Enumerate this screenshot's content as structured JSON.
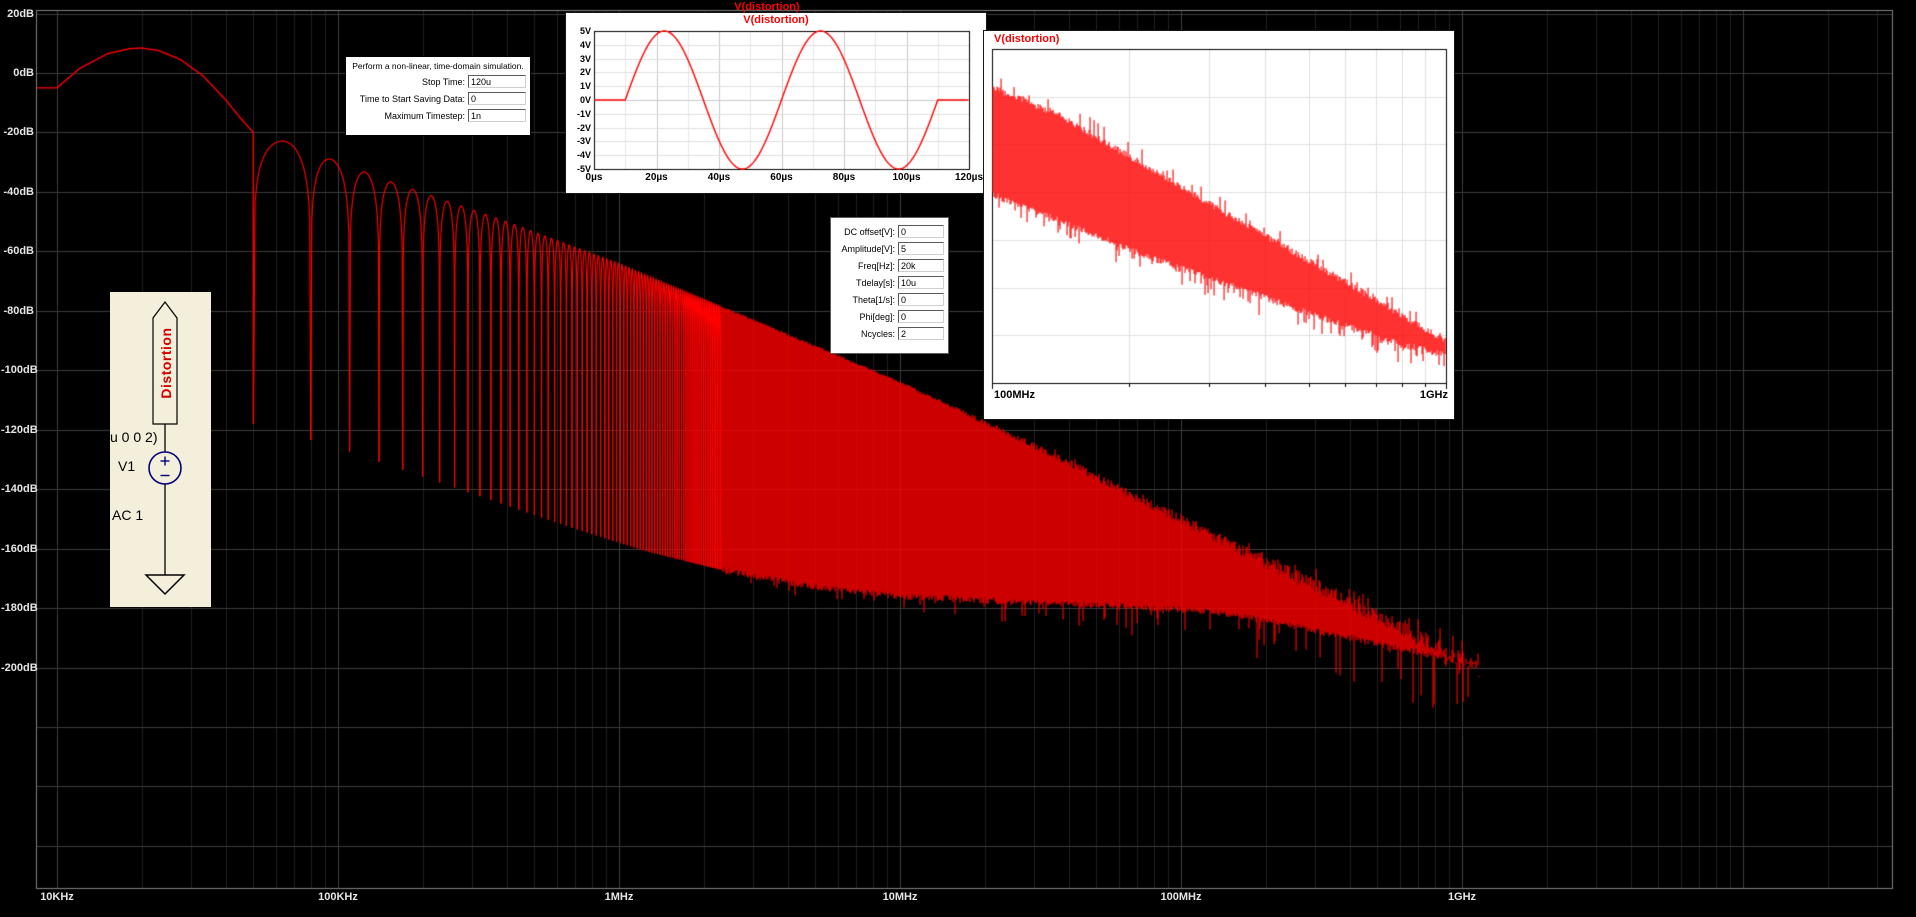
{
  "window": {
    "bg": "#000000"
  },
  "main_plot": {
    "title": "V(distortion)",
    "title_color": "#ff0000",
    "trace_color": "#ff0000",
    "grid_major": "#3d3d3d",
    "grid_minor": "#212121",
    "frame": "#828282",
    "label_color": "#e6e6e6",
    "y_labels": [
      "20dB",
      "0dB",
      "-20dB",
      "-40dB",
      "-60dB",
      "-80dB",
      "-100dB",
      "-120dB",
      "-140dB",
      "-160dB",
      "-180dB",
      "-200dB"
    ],
    "x_labels": [
      "10KHz",
      "100KHz",
      "1MHz",
      "10MHz",
      "100MHz",
      "1GHz"
    ]
  },
  "time_inset": {
    "title": "V(distortion)",
    "y_labels": [
      "5V",
      "4V",
      "3V",
      "2V",
      "1V",
      "0V",
      "-1V",
      "-2V",
      "-3V",
      "-4V",
      "-5V"
    ],
    "x_labels": [
      "0µs",
      "20µs",
      "40µs",
      "60µs",
      "80µs",
      "100µs",
      "120µs"
    ]
  },
  "zoom_inset": {
    "title": "V(distortion)",
    "x_labels": [
      "100MHz",
      "1GHz"
    ]
  },
  "transient_dialog": {
    "description": "Perform a non-linear, time-domain simulation.",
    "fields": [
      {
        "label": "Stop Time:",
        "value": "120u"
      },
      {
        "label": "Time to Start Saving Data:",
        "value": "0"
      },
      {
        "label": "Maximum Timestep:",
        "value": "1n"
      }
    ]
  },
  "sine_dialog": {
    "fields": [
      {
        "label": "DC offset[V]:",
        "value": "0"
      },
      {
        "label": "Amplitude[V]:",
        "value": "5"
      },
      {
        "label": "Freq[Hz]:",
        "value": "20k"
      },
      {
        "label": "Tdelay[s]:",
        "value": "10u"
      },
      {
        "label": "Theta[1/s]:",
        "value": "0"
      },
      {
        "label": "Phi[deg]:",
        "value": "0"
      },
      {
        "label": "Ncycles:",
        "value": "2"
      }
    ]
  },
  "schematic": {
    "net_label": "Distortion",
    "clipped_text": "u 0 0 2)",
    "ref": "V1",
    "value": "AC 1",
    "bg": "#f4efda",
    "symbol_color": "#00007f"
  },
  "chart_data": [
    {
      "id": "main-fft-spectrum",
      "type": "line",
      "title": "V(distortion)",
      "x_axis": {
        "scale": "log",
        "ticks": [
          "10KHz",
          "100KHz",
          "1MHz",
          "10MHz",
          "100MHz",
          "1GHz"
        ],
        "tick_hz": [
          10000,
          100000,
          1000000,
          10000000,
          100000000,
          1000000000
        ]
      },
      "y_axis": {
        "unit": "dB",
        "ticks_db": [
          20,
          0,
          -20,
          -40,
          -60,
          -80,
          -100,
          -120,
          -140,
          -160,
          -180,
          -200
        ]
      },
      "series": [
        {
          "name": "V(distortion)",
          "color": "#ff0000",
          "peak": {
            "freq_hz": 20000,
            "db": 8.4
          },
          "first_null_hz": 50000,
          "lobe_spacing_hz": 30000,
          "end_log10f": 9.06,
          "main_lobe_log10f_db": [
            [
              4.0,
              -5
            ],
            [
              4.08,
              1.5
            ],
            [
              4.18,
              6.5
            ],
            [
              4.26,
              8.2
            ],
            [
              4.3,
              8.4
            ],
            [
              4.36,
              7.6
            ],
            [
              4.44,
              4.5
            ],
            [
              4.52,
              -1
            ],
            [
              4.6,
              -9
            ],
            [
              4.66,
              -16
            ],
            [
              4.699,
              -20
            ]
          ],
          "envelope_top_log10f_db": [
            [
              4.699,
              -20.5
            ],
            [
              4.75,
              -21.5
            ],
            [
              4.85,
              -24
            ],
            [
              5.0,
              -30
            ],
            [
              5.2,
              -37
            ],
            [
              5.4,
              -43.5
            ],
            [
              5.6,
              -50
            ],
            [
              5.8,
              -57
            ],
            [
              6.0,
              -64
            ],
            [
              6.2,
              -72
            ],
            [
              6.4,
              -80
            ],
            [
              6.6,
              -88
            ],
            [
              6.8,
              -96
            ],
            [
              7.0,
              -104
            ],
            [
              7.2,
              -113
            ],
            [
              7.4,
              -122
            ],
            [
              7.6,
              -131
            ],
            [
              7.8,
              -141
            ],
            [
              8.0,
              -150
            ],
            [
              8.2,
              -160
            ],
            [
              8.4,
              -169
            ],
            [
              8.6,
              -178
            ],
            [
              8.8,
              -188
            ],
            [
              9.0,
              -197
            ],
            [
              9.06,
              -200
            ]
          ],
          "noise_floor_log10f_db": [
            [
              4.699,
              -118
            ],
            [
              5.0,
              -126
            ],
            [
              5.4,
              -139
            ],
            [
              5.8,
              -152
            ],
            [
              6.1,
              -161
            ],
            [
              6.4,
              -168
            ],
            [
              6.7,
              -173
            ],
            [
              7.0,
              -176
            ],
            [
              7.4,
              -178
            ],
            [
              7.8,
              -179.5
            ],
            [
              8.1,
              -181
            ],
            [
              8.4,
              -186
            ],
            [
              8.7,
              -192
            ],
            [
              9.0,
              -198
            ],
            [
              9.06,
              -200
            ]
          ]
        }
      ]
    },
    {
      "id": "time-domain-waveform",
      "type": "line",
      "title": "V(distortion)",
      "x_axis": {
        "unit": "µs",
        "range_us": [
          0,
          120
        ],
        "ticks": [
          "0µs",
          "20µs",
          "40µs",
          "60µs",
          "80µs",
          "100µs",
          "120µs"
        ]
      },
      "y_axis": {
        "unit": "V",
        "range_v": [
          -5,
          5
        ],
        "ticks": [
          "5V",
          "4V",
          "3V",
          "2V",
          "1V",
          "0V",
          "-1V",
          "-2V",
          "-3V",
          "-4V",
          "-5V"
        ]
      },
      "series": [
        {
          "name": "V(distortion)",
          "color": "#ff0000",
          "waveform": "sine_burst",
          "amplitude_v": 5,
          "freq_hz": 20000,
          "tdelay_us": 10,
          "ncycles": 2
        }
      ]
    },
    {
      "id": "fft-zoom-100mhz-1ghz",
      "type": "line",
      "title": "V(distortion)",
      "x_axis": {
        "scale": "log",
        "range_hz": [
          100000000,
          1000000000
        ],
        "ticks": [
          "100MHz",
          "1GHz"
        ]
      },
      "approx_top_edge_db": [
        -150,
        -200
      ],
      "approx_bottom_edge_db": [
        -170,
        -203
      ],
      "band": {
        "color": "#ff0000",
        "top_frac": [
          [
            0,
            0.115
          ],
          [
            0.15,
            0.2
          ],
          [
            0.35,
            0.36
          ],
          [
            0.55,
            0.52
          ],
          [
            0.75,
            0.675
          ],
          [
            0.9,
            0.795
          ],
          [
            1.0,
            0.875
          ]
        ],
        "bottom_frac": [
          [
            0,
            0.435
          ],
          [
            0.15,
            0.515
          ],
          [
            0.35,
            0.625
          ],
          [
            0.55,
            0.72
          ],
          [
            0.75,
            0.815
          ],
          [
            0.9,
            0.885
          ],
          [
            1.0,
            0.915
          ]
        ]
      }
    }
  ]
}
